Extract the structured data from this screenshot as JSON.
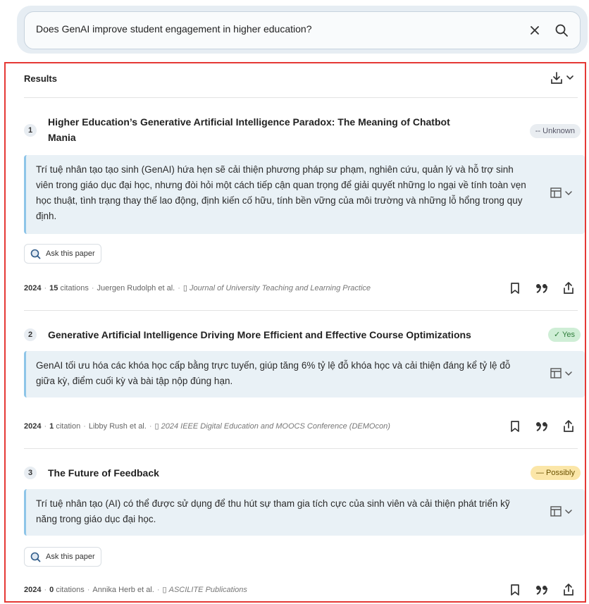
{
  "search": {
    "query": "Does GenAI improve student engagement in higher education?"
  },
  "results": {
    "heading": "Results",
    "papers": [
      {
        "index": "1",
        "title_line1": "Higher Education’s Generative Artificial Intelligence Paradox: The Meaning of Chatbot",
        "title_line2": "Mania",
        "badge": "-- Unknown",
        "summary": "Trí tuệ nhân tạo tạo sinh (GenAI) hứa hẹn sẽ cải thiện phương pháp sư phạm, nghiên cứu, quản lý và hỗ trợ sinh viên trong giáo dục đại học, nhưng đòi hỏi một cách tiếp cận quan trọng để giải quyết những lo ngại về tính toàn vẹn học thuật, tình trạng thay thế lao động, định kiến cố hữu, tính bền vững của môi trường và những lỗ hổng trong quy định.",
        "ask_label": "Ask this paper",
        "year": "2024",
        "cite_count": "15",
        "cite_word": "citations",
        "authors": "Juergen Rudolph et al.",
        "journal": "Journal of University Teaching and Learning Practice"
      },
      {
        "index": "2",
        "title_line1": "Generative Artificial Intelligence Driving More Efficient and Effective Course Optimizations",
        "badge": "✓ Yes",
        "summary": "GenAI tối ưu hóa các khóa học cấp bằng trực tuyến, giúp tăng 6% tỷ lệ đỗ khóa học và cải thiện đáng kể tỷ lệ đỗ giữa kỳ, điểm cuối kỳ và bài tập nộp đúng hạn.",
        "year": "2024",
        "cite_count": "1",
        "cite_word": "citation",
        "authors": "Libby Rush et al.",
        "journal": "2024 IEEE Digital Education and MOOCS Conference (DEMOcon)"
      },
      {
        "index": "3",
        "title_line1": "The Future of Feedback",
        "badge": "— Possibly",
        "summary": "Trí tuệ nhân tạo (AI) có thể được sử dụng để thu hút sự tham gia tích cực của sinh viên và cải thiện phát triển kỹ năng trong giáo dục đại học.",
        "ask_label": "Ask this paper",
        "year": "2024",
        "cite_count": "0",
        "cite_word": "citations",
        "authors": "Annika Herb et al.",
        "journal": "ASCILITE Publications"
      }
    ]
  },
  "icons": {
    "clear": "close-icon",
    "search": "search-icon",
    "download": "download-icon",
    "table": "table-icon",
    "bookmark": "bookmark-icon",
    "cite": "quote-icon",
    "share": "share-icon",
    "ask": "chat-search-icon",
    "journal": "book-icon"
  },
  "colors": {
    "accent_border": "#8ec5e8",
    "frame": "#e53935",
    "yes": "#2e7d3a",
    "possibly": "#fbe6a8"
  }
}
